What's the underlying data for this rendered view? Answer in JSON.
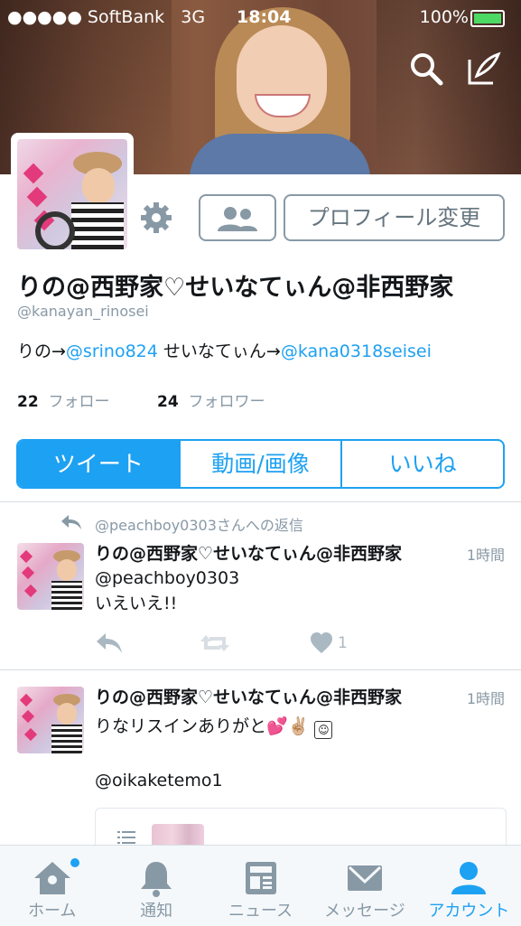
{
  "status_bar": {
    "carrier": "●●●●● SoftBank",
    "network": "3G",
    "time": "18:04",
    "battery": "100%"
  },
  "colors": {
    "accent": "#1da1f2",
    "text": "#14171a",
    "muted": "#8899a6"
  },
  "profile": {
    "name": "りの@西野家♡せいなてぃん@非西野家",
    "handle": "@kanayan_rinosei",
    "bio": {
      "text1": "りの→",
      "link1": "@srino824",
      "text2": " せいなてぃん→",
      "link2": "@kana0318seisei"
    },
    "following_count": "22",
    "following_label": "フォロー",
    "followers_count": "24",
    "followers_label": "フォロワー",
    "edit_button": "プロフィール変更"
  },
  "tabs": [
    "ツイート",
    "動画/画像",
    "いいね"
  ],
  "tweets": [
    {
      "reply_context": "@peachboy0303さんへの返信",
      "name": "りの@西野家♡せいなてぃん@非西野家",
      "time": "1時間",
      "text": "@peachboy0303\nいえいえ!!",
      "like_count": "1"
    },
    {
      "name": "りの@西野家♡せいなてぃん@非西野家",
      "time": "1時間",
      "text": "りなリスインありがと💕✌🏼",
      "mention": "@oikaketemo1"
    }
  ],
  "bottom_nav": [
    "ホーム",
    "通知",
    "ニュース",
    "メッセージ",
    "アカウント"
  ],
  "icons": [
    "search-icon",
    "compose-icon",
    "gear-icon",
    "people-icon",
    "reply-icon",
    "retweet-icon",
    "heart-icon",
    "home-icon",
    "bell-icon",
    "news-icon",
    "mail-icon",
    "account-icon"
  ]
}
